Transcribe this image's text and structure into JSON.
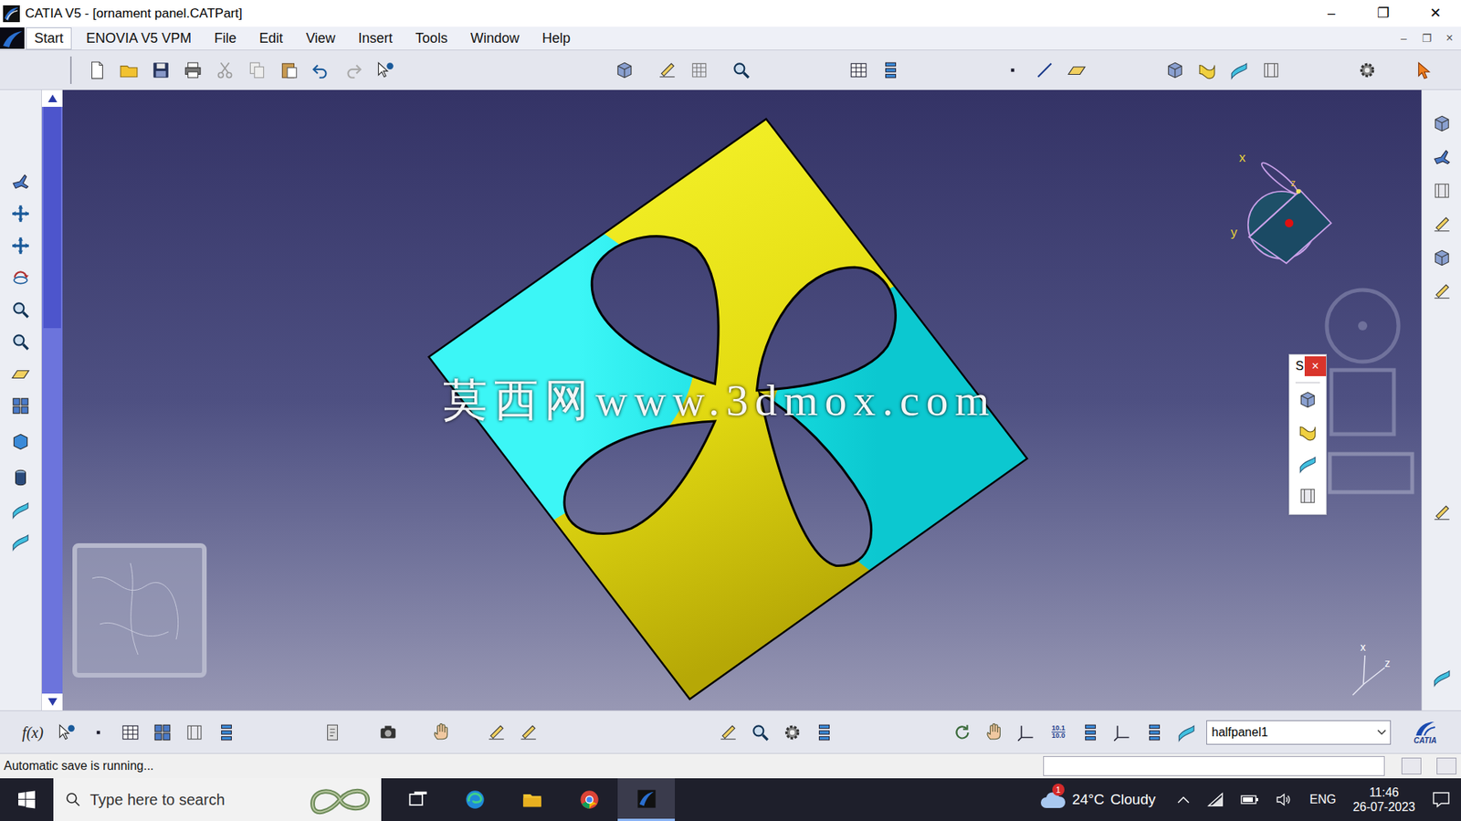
{
  "window": {
    "title": "CATIA V5 - [ornament panel.CATPart]",
    "controls": [
      "–",
      "❐",
      "✕"
    ]
  },
  "menu": {
    "items": [
      {
        "label": "Start",
        "selected": true
      },
      {
        "label": "ENOVIA V5 VPM",
        "selected": false
      },
      {
        "label": "File",
        "selected": false
      },
      {
        "label": "Edit",
        "selected": false
      },
      {
        "label": "View",
        "selected": false
      },
      {
        "label": "Insert",
        "selected": false
      },
      {
        "label": "Tools",
        "selected": false
      },
      {
        "label": "Window",
        "selected": false
      },
      {
        "label": "Help",
        "selected": false
      }
    ],
    "document_controls": [
      "–",
      "❐",
      "×"
    ]
  },
  "viewport": {
    "watermark": "莫西网www.3dmox.com",
    "compass": {
      "x": "x",
      "y": "y",
      "z": "z"
    },
    "axis": {
      "x": "x",
      "z": "z"
    }
  },
  "floating_toolbar": {
    "title": "S",
    "close": "×"
  },
  "bottom_toolbar": {
    "formula": "f(x)",
    "scale": [
      "10.1",
      "10.0"
    ],
    "dropdown": {
      "value": "halfpanel1"
    },
    "brand": "CATIA"
  },
  "status_bar": {
    "message": "Automatic save is running..."
  },
  "taskbar": {
    "search": {
      "placeholder": "Type here to search"
    },
    "apps": [
      {
        "selected": false
      },
      {
        "selected": false
      },
      {
        "selected": false
      },
      {
        "selected": false
      },
      {
        "selected": true
      }
    ],
    "weather": {
      "badge": "1",
      "temperature": "24°C",
      "condition": "Cloudy"
    },
    "language": "ENG",
    "time": "11:46",
    "date": "26-07-2023"
  }
}
